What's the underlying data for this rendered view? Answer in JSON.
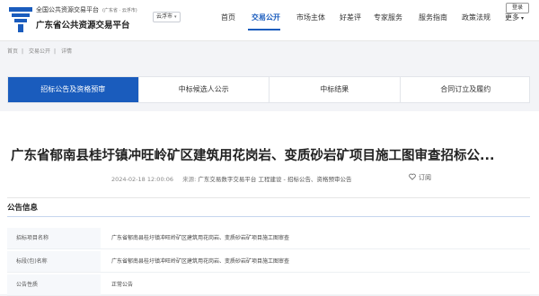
{
  "header": {
    "brand_top": "全国公共资源交易平台",
    "brand_top_sub": "(广东省 · 云浮市)",
    "brand_main": "广东省公共资源交易平台",
    "city": "云浮市",
    "login": "登录",
    "nav": [
      "首页",
      "交易公开",
      "市场主体",
      "好差评",
      "专家服务",
      "服务指南",
      "政策法规",
      "更多"
    ],
    "nav_active_index": 1,
    "accent_color": "#1a5cbd"
  },
  "breadcrumb": [
    "首页",
    "交易公开",
    "详情"
  ],
  "tabs": [
    "招标公告及资格预审",
    "中标候选人公示",
    "中标结果",
    "合同订立及履约"
  ],
  "article": {
    "title": "广东省郁南县桂圩镇冲旺岭矿区建筑用花岗岩、变质砂岩矿项目施工图审查招标公...",
    "datetime": "2024-02-18 12:00:06",
    "source_label": "来源:",
    "source": "广东交易数字交易平台 工程建设 - 招标公告、资格预审公告",
    "subscribe": "订阅"
  },
  "section": {
    "title": "公告信息",
    "rows": [
      {
        "label": "招标项目名称",
        "value": "广东省郁南县桂圩镇冲旺岭矿区建筑用花岗岩、变质砂岩矿项目施工图审查"
      },
      {
        "label": "标段(包)名称",
        "value": "广东省郁南县桂圩镇冲旺岭矿区建筑用花岗岩、变质砂岩矿项目施工图审查"
      },
      {
        "label": "公告性质",
        "value": "正常公告"
      }
    ]
  }
}
